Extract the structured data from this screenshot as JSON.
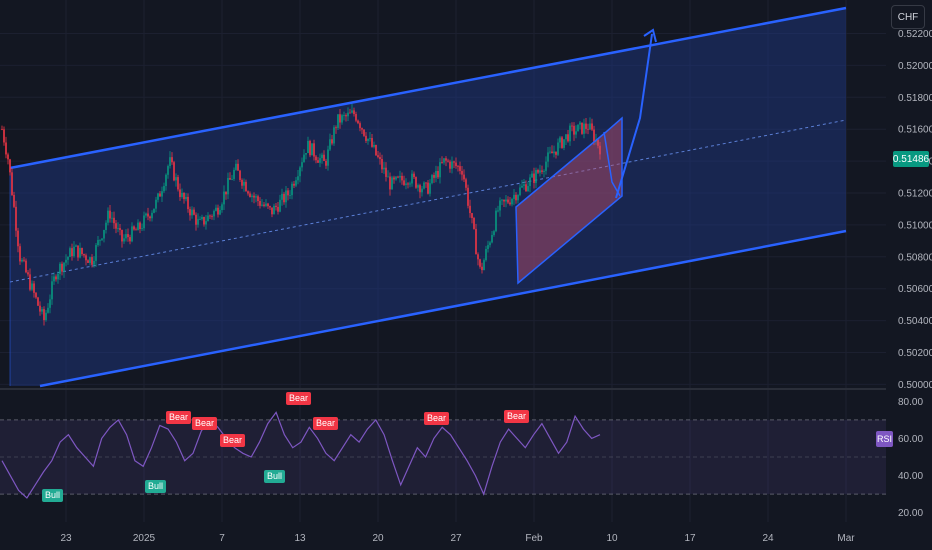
{
  "currency": "CHF",
  "current_price": "0.51486",
  "rsi_label": "RSI",
  "colors": {
    "background": "#131722",
    "channel_line": "#2962ff",
    "channel_fill": "#1e3a8a",
    "midline": "#5b7fd6",
    "up": "#089981",
    "down": "#f23645",
    "rsi": "#7e57c2",
    "wedge": "#c2506a"
  },
  "chart_data": [
    {
      "type": "candlestick",
      "title": "",
      "price_axis": {
        "ticks": [
          "0.52200",
          "0.52000",
          "0.51800",
          "0.51600",
          "0.51400",
          "0.51200",
          "0.51000",
          "0.50800",
          "0.50600",
          "0.50400",
          "0.50200",
          "0.50000"
        ],
        "range": [
          0.4999,
          0.5241
        ]
      },
      "time_axis": {
        "ticks": [
          "23",
          "2025",
          "7",
          "13",
          "20",
          "27",
          "Feb",
          "10",
          "17",
          "24",
          "Mar"
        ]
      },
      "close_path": [
        [
          0,
          0.516
        ],
        [
          0.01,
          0.5142
        ],
        [
          0.03,
          0.508
        ],
        [
          0.05,
          0.506
        ],
        [
          0.07,
          0.504
        ],
        [
          0.09,
          0.507
        ],
        [
          0.12,
          0.5085
        ],
        [
          0.15,
          0.5078
        ],
        [
          0.18,
          0.5108
        ],
        [
          0.2,
          0.509
        ],
        [
          0.23,
          0.5098
        ],
        [
          0.26,
          0.5115
        ],
        [
          0.28,
          0.514
        ],
        [
          0.3,
          0.5118
        ],
        [
          0.33,
          0.51
        ],
        [
          0.36,
          0.511
        ],
        [
          0.39,
          0.5135
        ],
        [
          0.42,
          0.5118
        ],
        [
          0.45,
          0.5108
        ],
        [
          0.48,
          0.512
        ],
        [
          0.51,
          0.515
        ],
        [
          0.54,
          0.5138
        ],
        [
          0.56,
          0.5165
        ],
        [
          0.59,
          0.517
        ],
        [
          0.62,
          0.5148
        ],
        [
          0.65,
          0.5125
        ],
        [
          0.68,
          0.513
        ],
        [
          0.71,
          0.5122
        ],
        [
          0.74,
          0.514
        ],
        [
          0.77,
          0.5135
        ],
        [
          0.8,
          0.507
        ],
        [
          0.83,
          0.511
        ],
        [
          0.86,
          0.512
        ],
        [
          0.89,
          0.513
        ],
        [
          0.92,
          0.5145
        ],
        [
          0.95,
          0.5158
        ],
        [
          0.98,
          0.5162
        ],
        [
          1,
          0.51486
        ]
      ],
      "last_price": 0.51486
    },
    {
      "type": "line",
      "title": "",
      "series": [
        {
          "name": "RSI",
          "values": [
            48,
            40,
            32,
            28,
            35,
            42,
            48,
            58,
            62,
            55,
            50,
            45,
            60,
            66,
            70,
            62,
            48,
            45,
            55,
            67,
            65,
            58,
            48,
            52,
            64,
            70,
            66,
            60,
            55,
            52,
            50,
            58,
            68,
            74,
            62,
            55,
            58,
            66,
            60,
            52,
            48,
            55,
            62,
            58,
            65,
            70,
            62,
            48,
            35,
            45,
            55,
            50,
            60,
            66,
            62,
            55,
            48,
            40,
            30,
            45,
            58,
            65,
            60,
            55,
            62,
            68,
            60,
            52,
            58,
            72,
            65,
            60,
            62
          ]
        }
      ],
      "y_ticks": [
        "80.00",
        "60.00",
        "40.00",
        "20.00"
      ],
      "ylim": [
        15,
        85
      ],
      "bands": [
        30,
        70
      ]
    }
  ],
  "signals": [
    {
      "label": "Bear",
      "kind": "bear"
    },
    {
      "label": "Bear",
      "kind": "bear"
    },
    {
      "label": "Bear",
      "kind": "bear"
    },
    {
      "label": "Bear",
      "kind": "bear"
    },
    {
      "label": "Bear",
      "kind": "bear"
    },
    {
      "label": "Bear",
      "kind": "bear"
    },
    {
      "label": "Bear",
      "kind": "bear"
    },
    {
      "label": "Bull",
      "kind": "bull"
    },
    {
      "label": "Bull",
      "kind": "bull"
    },
    {
      "label": "Bull",
      "kind": "bull"
    }
  ]
}
